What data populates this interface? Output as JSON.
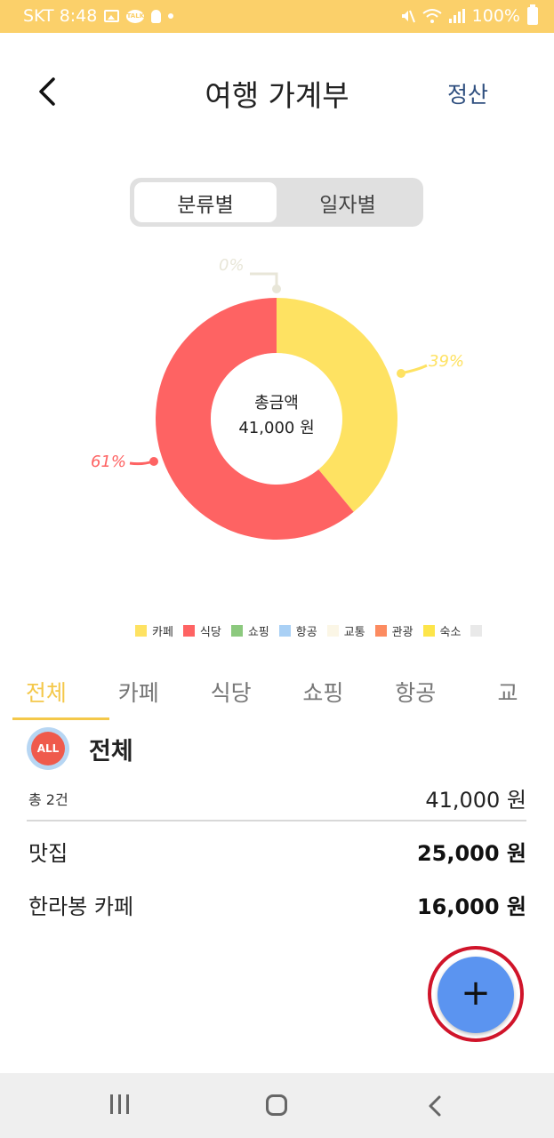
{
  "status_bar": {
    "carrier_time": "SKT 8:48",
    "talk_icon_text": "TALK",
    "battery": "100%",
    "icons": [
      "gallery-icon",
      "kakaotalk-icon",
      "bulb-icon",
      "dot-icon",
      "mute-icon",
      "wifi-icon",
      "signal-icon",
      "battery-icon"
    ]
  },
  "header": {
    "title": "여행 가계부",
    "back_icon": "chevron-left-icon",
    "settle_label": "정산"
  },
  "segment": {
    "options": [
      "분류별",
      "일자별"
    ],
    "selected": "분류별"
  },
  "chart_data": {
    "type": "pie",
    "donut": true,
    "center_label": [
      "총금액",
      "41,000 원"
    ],
    "slices": [
      {
        "label": "카페",
        "percent": 39,
        "color": "#fee262",
        "display": "39%"
      },
      {
        "label": "식당",
        "percent": 61,
        "color": "#fe6363",
        "display": "61%"
      },
      {
        "label": "",
        "percent": 0,
        "color": "#e8e6d8",
        "display": "0%"
      }
    ],
    "legend": [
      {
        "label": "카페",
        "color": "#fee262"
      },
      {
        "label": "식당",
        "color": "#fe6363"
      },
      {
        "label": "쇼핑",
        "color": "#8cc97e"
      },
      {
        "label": "항공",
        "color": "#a9d0f5"
      },
      {
        "label": "교통",
        "color": "#fbf6e6"
      },
      {
        "label": "관광",
        "color": "#fc8b60"
      },
      {
        "label": "숙소",
        "color": "#fde54a"
      },
      {
        "label": "",
        "color": "#e9e9e9"
      }
    ]
  },
  "tabs": {
    "items": [
      "전체",
      "카페",
      "식당",
      "쇼핑",
      "항공",
      "교"
    ],
    "selected": "전체"
  },
  "section": {
    "badge": "ALL",
    "title": "전체",
    "count": "총 2건",
    "total": "41,000 원"
  },
  "expenses": [
    {
      "name": "맛집",
      "amount": "25,000 원"
    },
    {
      "name": "한라봉 카페",
      "amount": "16,000 원"
    }
  ],
  "fab": {
    "label": "+"
  },
  "colors": {
    "status_bar": "#fbd06a",
    "accent_yellow": "#f4c84a",
    "fab_blue": "#5b94f0",
    "highlight_ring": "#d0142a",
    "settle_text": "#2f4f7f"
  }
}
